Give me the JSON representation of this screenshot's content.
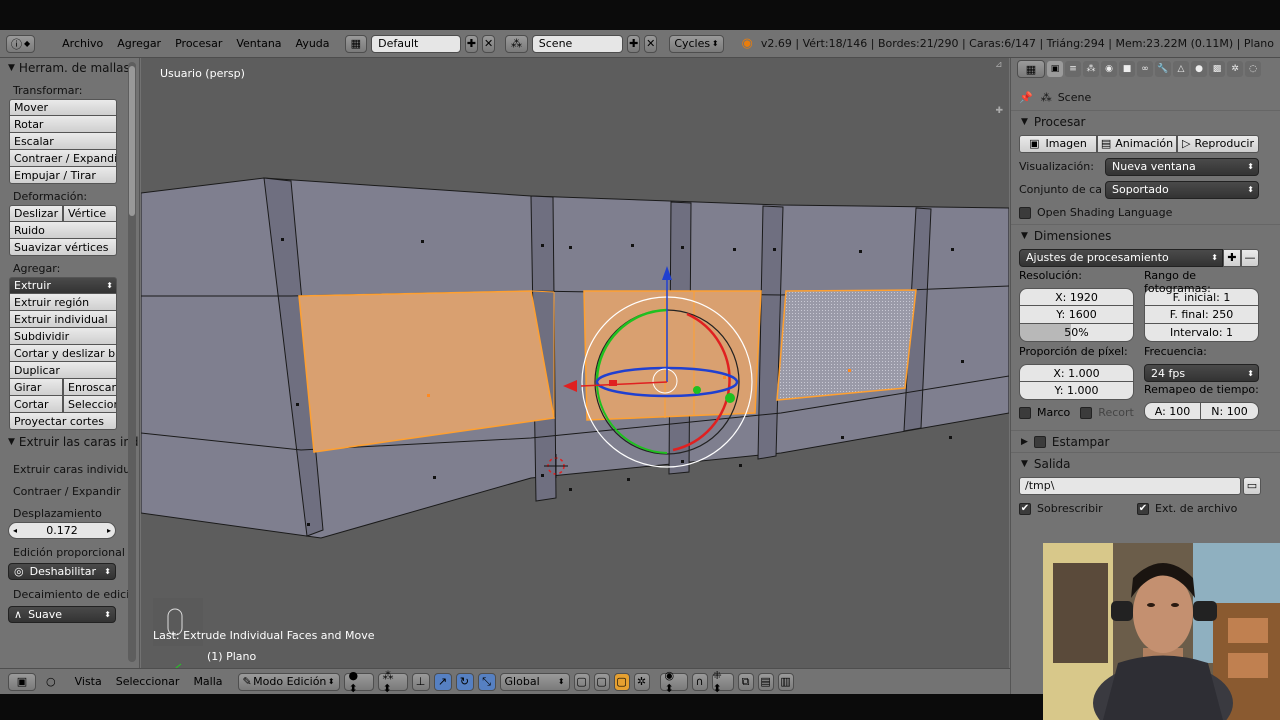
{
  "header": {
    "menus": [
      "Archivo",
      "Agregar",
      "Procesar",
      "Ventana",
      "Ayuda"
    ],
    "screen_layout": "Default",
    "scene": "Scene",
    "engine": "Cycles",
    "stats": "v2.69 | Vért:18/146 | Bordes:21/290 | Caras:6/147 | Triáng:294 | Mem:23.22M (0.11M) | Plano"
  },
  "toolshelf": {
    "title": "Herram. de mallas",
    "transform_label": "Transformar:",
    "transform_items": [
      "Mover",
      "Rotar",
      "Escalar",
      "Contraer / Expandir",
      "Empujar / Tirar"
    ],
    "deform_label": "Deformación:",
    "deform_pair": [
      "Deslizar b",
      "Vértice"
    ],
    "deform_items": [
      "Ruido",
      "Suavizar vértices"
    ],
    "add_label": "Agregar:",
    "add_dropdown": "Extruir",
    "add_items": [
      "Extruir región",
      "Extruir individual",
      "Subdividir",
      "Cortar y deslizar bucle",
      "Duplicar"
    ],
    "pair1": [
      "Girar",
      "Enroscar"
    ],
    "pair2": [
      "Cortar",
      "Seleccion"
    ],
    "last_item": "Proyectar cortes",
    "op_title": "Extruir las caras ind",
    "op_items": [
      "Extruir caras individua",
      "Contraer / Expandir"
    ],
    "disp_label": "Desplazamiento",
    "disp_value": "0.172",
    "prop_edit_label": "Edición proporcional",
    "prop_edit_value": "Deshabilitar",
    "falloff_label": "Decaimiento de edici",
    "falloff_value": "Suave"
  },
  "viewport": {
    "view_label": "Usuario (persp)",
    "last_op": "Last: Extrude Individual Faces and Move",
    "object_label": "(1) Plano",
    "colors": {
      "face": "#7d7d8c",
      "selected": "#d9a070",
      "edge_sel": "#ffa030"
    }
  },
  "bottombar": {
    "items": [
      "Vista",
      "Seleccionar",
      "Malla"
    ],
    "mode": "Modo Edición",
    "orientation": "Global"
  },
  "properties": {
    "scene_label": "Scene",
    "render_title": "Procesar",
    "render_buttons": [
      "Imagen",
      "Animación",
      "Reproducir"
    ],
    "display_label": "Visualización:",
    "display_value": "Nueva ventana",
    "feature_label": "Conjunto de ca",
    "feature_value": "Soportado",
    "osl_label": "Open Shading Language",
    "dimensions_title": "Dimensiones",
    "presets": "Ajustes de procesamiento",
    "resolution_label": "Resolución:",
    "res_x": "X: 1920",
    "res_y": "Y: 1600",
    "res_pct": "50%",
    "frame_range_label": "Rango de fotogramas:",
    "frame_start": "F. inicial: 1",
    "frame_end": "F. final: 250",
    "frame_step": "Intervalo: 1",
    "aspect_label": "Proporción de píxel:",
    "aspect_x": "X: 1.000",
    "aspect_y": "Y: 1.000",
    "fps_label": "Frecuencia:",
    "fps_value": "24 fps",
    "remap_label": "Remapeo de tiempo:",
    "remap_old": "A: 100",
    "remap_new": "N: 100",
    "border_label": "Marco",
    "crop_label": "Recort",
    "stamp_title": "Estampar",
    "output_title": "Salida",
    "output_path": "/tmp\\",
    "overwrite_label": "Sobrescribir",
    "ext_label": "Ext. de archivo"
  }
}
